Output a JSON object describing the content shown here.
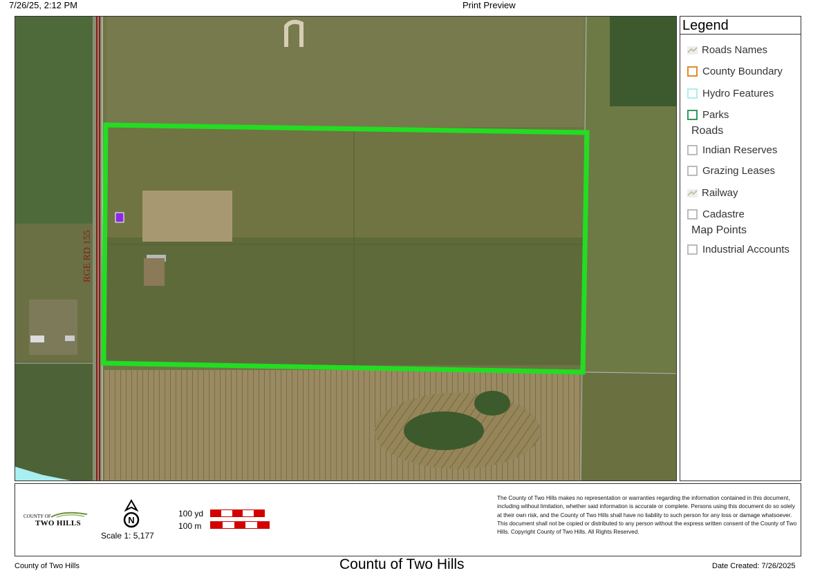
{
  "header": {
    "datetime": "7/26/25, 2:12 PM",
    "title": "Print Preview"
  },
  "map": {
    "road_label": "RGE RD 155",
    "parcel_outline_color": "#22dd22",
    "road_color": "#8b1a1a"
  },
  "legend": {
    "title": "Legend",
    "items": [
      {
        "label": "Roads Names",
        "icon": "road-line-icon"
      },
      {
        "label": "County Boundary",
        "color": "#e0892a"
      },
      {
        "label": "Hydro Features",
        "color": "#a9eef0"
      },
      {
        "label": "Parks",
        "color": "#2e9a5c"
      },
      {
        "group": "Roads"
      },
      {
        "label": "Indian Reserves",
        "color": "#bbbbbb"
      },
      {
        "label": "Grazing Leases",
        "color": "#bbbbbb"
      },
      {
        "label": "Railway",
        "icon": "railway-line-icon"
      },
      {
        "label": "Cadastre",
        "color": "#bbbbbb"
      },
      {
        "group": "Map Points"
      },
      {
        "label": "Industrial Accounts",
        "color": "#bbbbbb"
      }
    ]
  },
  "footer": {
    "logo_small": "COUNTY OF",
    "logo_main": "TWO HILLS",
    "north_label": "N",
    "scale_text": "Scale 1: 5,177",
    "scale_yd": "100 yd",
    "scale_m": "100 m",
    "disclaimer": "The County of Two Hills makes no representation or warranties regarding the information contained in this document, including without limitation, whether said information is accurate or complete. Persons using this document do so solely at their own risk, and the County of Two Hills shall have no liability to such person for any loss or damage whatsoever. This document shall not be copied or distributed to any person without the express written consent of the County of Two Hills. Copyright County of Two Hills. All Rights Reserved.",
    "left": "County of Two Hills",
    "title": "Countu of Two Hills",
    "date": "Date Created: 7/26/2025"
  }
}
